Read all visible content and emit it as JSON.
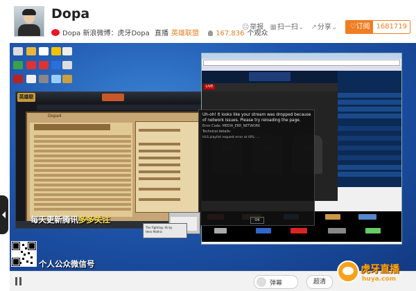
{
  "header": {
    "streamer_name": "Dopa",
    "weibo_text": "Dopa 新浪微博：虎牙Dopa",
    "category_prefix": "直播",
    "category": "英雄联盟",
    "viewers": "167,836",
    "viewers_suffix": "个观众",
    "report_label": "举报",
    "scan_label": "扫一扫",
    "share_label": "分享",
    "subscribe_label": "订阅",
    "subscriber_count": "1681719"
  },
  "stream": {
    "overlay_line1_white": "每天更新腾讯",
    "overlay_line1_yellow": "多多关注",
    "overlay_line2": "个人公众微信号",
    "lol_logo_text": "英雄联盟",
    "lol_player_name": "Dopa4",
    "esl_live_badge": "LIVE",
    "error_title": "Uh-oh! It looks like your stream was dropped because of network issues. Please try reloading the page.",
    "error_code": "Error Code: MEDIA_ERR_NETWORK",
    "error_detail": "Technical details:",
    "error_url": "HLS playlist request error at URL: ...",
    "error_ok": "OK",
    "small_window_line1": "The Fighting: 4k by",
    "small_window_line2": "Hero Mathis"
  },
  "controls": {
    "danmaku_label": "弹幕",
    "quality_label": "超清"
  },
  "branding": {
    "huya_name": "虎牙直播",
    "huya_url": "huya.com"
  },
  "colors": {
    "accent_orange": "#f07d22",
    "desktop_blue": "#1e56ad",
    "huya_gold": "#f7a21b"
  }
}
